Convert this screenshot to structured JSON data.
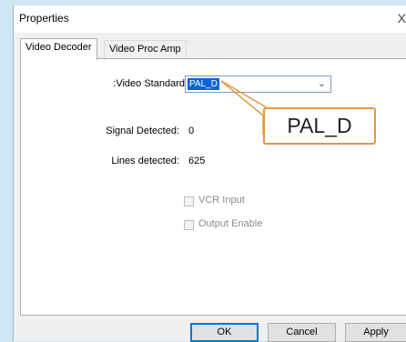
{
  "dialog": {
    "title": "Properties",
    "close_glyph": "X"
  },
  "tabs": [
    {
      "label": "Video Decoder",
      "active": true
    },
    {
      "label": "Video Proc Amp",
      "active": false
    }
  ],
  "video_decoder": {
    "video_standard_label": ":Video Standard",
    "video_standard_value": "PAL_D",
    "signal_detected_label": "Signal Detected:",
    "signal_detected_value": "0",
    "lines_detected_label": "Lines detected:",
    "lines_detected_value": "625",
    "vcr_input_label": "VCR Input",
    "vcr_input_checked": false,
    "output_enable_label": "Output Enable",
    "output_enable_checked": false
  },
  "buttons": {
    "ok": "OK",
    "cancel": "Cancel",
    "apply": "Apply"
  },
  "callout": {
    "text": "PAL_D",
    "color": "#e39a3f"
  },
  "colors": {
    "selection": "#0a64d6",
    "default_button_border": "#0078d7",
    "background": "#cfe6f3"
  }
}
